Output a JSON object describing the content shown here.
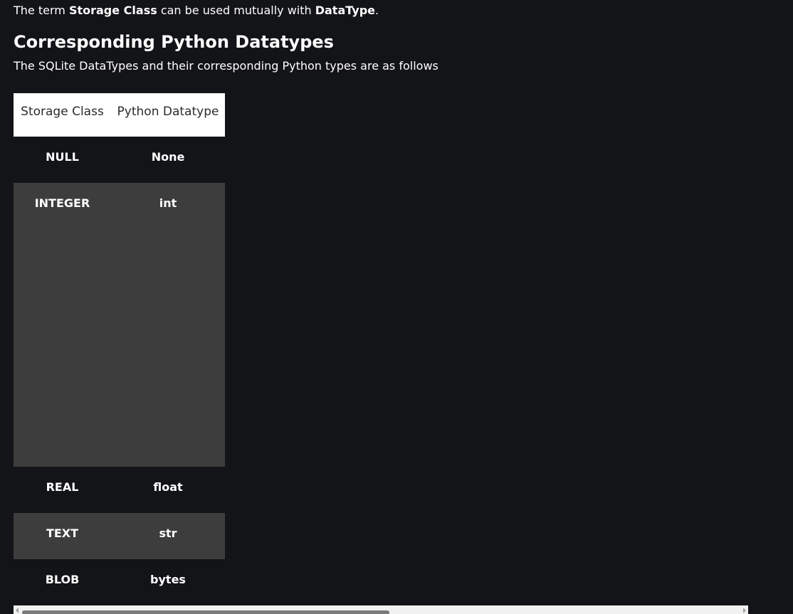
{
  "intro": {
    "prefix": "The term ",
    "term1": "Storage Class",
    "middle": " can be used mutually with ",
    "term2": "DataType",
    "suffix": "."
  },
  "heading": "Corresponding Python Datatypes",
  "subheading": "The SQLite DataTypes and their corresponding Python types are as follows",
  "table": {
    "headers": [
      "Storage Class",
      "Python Datatype"
    ],
    "rows": [
      [
        "NULL",
        "None"
      ],
      [
        "INTEGER",
        "int"
      ],
      [
        "REAL",
        "float"
      ],
      [
        "TEXT",
        "str"
      ],
      [
        "BLOB",
        "bytes"
      ]
    ]
  },
  "colors": {
    "background": "#131417",
    "row_alt": "#3d3d3d",
    "header_bg": "#ffffff",
    "header_text": "#2b2b2b",
    "text": "#ffffff"
  }
}
